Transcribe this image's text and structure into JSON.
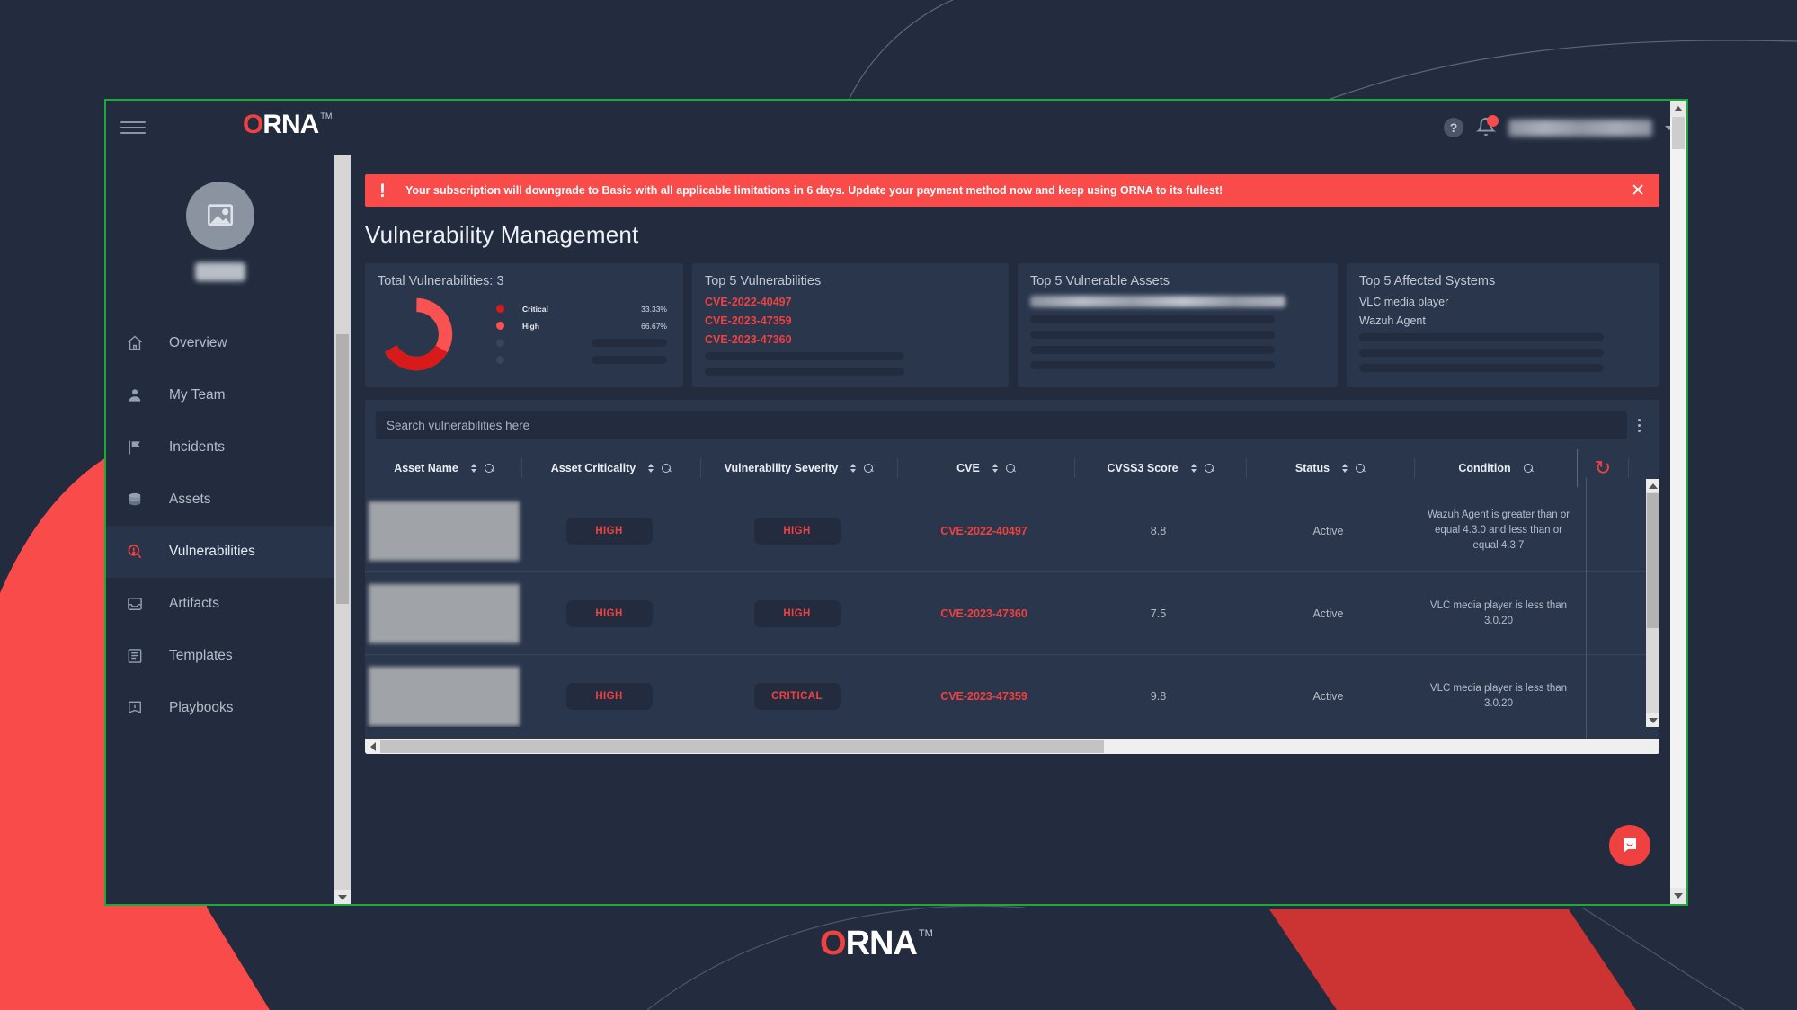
{
  "brand": {
    "name_o": "O",
    "name_rest": "RNA",
    "tm": "TM",
    "accent_red": "#f04141",
    "bg_navy": "#222c3e",
    "card_navy": "#2a364c",
    "border_green": "#1ea838"
  },
  "appbar": {
    "menu_icon": "hamburger-icon",
    "help_icon": "?",
    "bell_icon": "bell-icon",
    "user_email_redacted": "",
    "caret": "chevron-down-icon"
  },
  "sidebar": {
    "avatar_icon": "image-placeholder-icon",
    "user_name_redacted": "",
    "items": [
      {
        "label": "Overview",
        "icon": "home-icon",
        "active": false
      },
      {
        "label": "My Team",
        "icon": "user-icon",
        "active": false
      },
      {
        "label": "Incidents",
        "icon": "flag-icon",
        "active": false
      },
      {
        "label": "Assets",
        "icon": "database-icon",
        "active": false
      },
      {
        "label": "Vulnerabilities",
        "icon": "search-alert-icon",
        "active": true
      },
      {
        "label": "Artifacts",
        "icon": "inbox-icon",
        "active": false
      },
      {
        "label": "Templates",
        "icon": "document-icon",
        "active": false
      },
      {
        "label": "Playbooks",
        "icon": "book-icon",
        "active": false
      }
    ]
  },
  "alert": {
    "icon": "exclamation-icon",
    "message": "Your subscription will downgrade to Basic with all applicable limitations in 6 days. Update your payment method now and keep using ORNA to its fullest!",
    "close": "✕"
  },
  "page": {
    "title": "Vulnerability Management"
  },
  "cards": {
    "total": {
      "title": "Total Vulnerabilities: 3"
    },
    "top_vulns": {
      "title": "Top 5 Vulnerabilities",
      "items": [
        "CVE-2022-40497",
        "CVE-2023-47359",
        "CVE-2023-47360"
      ],
      "placeholders": 2
    },
    "top_assets": {
      "title": "Top 5 Vulnerable Assets",
      "redacted_items": 1,
      "placeholders": 4
    },
    "top_systems": {
      "title": "Top 5 Affected Systems",
      "items": [
        "VLC media player",
        "Wazuh Agent"
      ],
      "placeholders": 3
    }
  },
  "chart_data": {
    "type": "pie",
    "title": "Total Vulnerabilities: 3",
    "labels": [
      "Critical",
      "High"
    ],
    "values": [
      33.33,
      66.67
    ],
    "value_labels": [
      "33.33%",
      "66.67%"
    ],
    "colors": [
      "#d81a1a",
      "#fa5151"
    ],
    "legend": "right",
    "donut": true,
    "empty_legend_rows": 2
  },
  "search": {
    "placeholder": "Search vulnerabilities here",
    "value": "",
    "menu_icon": "kebab-menu-icon"
  },
  "table": {
    "columns": [
      {
        "label": "Asset Name",
        "sortable": true,
        "searchable": true
      },
      {
        "label": "Asset Criticality",
        "sortable": true,
        "searchable": true
      },
      {
        "label": "Vulnerability Severity",
        "sortable": true,
        "searchable": true
      },
      {
        "label": "CVE",
        "sortable": true,
        "searchable": true
      },
      {
        "label": "CVSS3 Score",
        "sortable": true,
        "searchable": true
      },
      {
        "label": "Status",
        "sortable": true,
        "searchable": true
      },
      {
        "label": "Condition",
        "sortable": false,
        "searchable": true
      }
    ],
    "refresh_icon": "refresh-icon",
    "rows": [
      {
        "asset_name_redacted": "",
        "criticality": "HIGH",
        "severity": "HIGH",
        "cve": "CVE-2022-40497",
        "score": "8.8",
        "status": "Active",
        "condition": "Wazuh Agent is greater than or equal 4.3.0 and less than or equal 4.3.7"
      },
      {
        "asset_name_redacted": "",
        "criticality": "HIGH",
        "severity": "HIGH",
        "cve": "CVE-2023-47360",
        "score": "7.5",
        "status": "Active",
        "condition": "VLC media player is less than 3.0.20"
      },
      {
        "asset_name_redacted": "",
        "criticality": "HIGH",
        "severity": "CRITICAL",
        "cve": "CVE-2023-47359",
        "score": "9.8",
        "status": "Active",
        "condition": "VLC media player is less than 3.0.20"
      }
    ]
  },
  "chat": {
    "icon": "chat-bubble-icon"
  },
  "footer": {
    "logo_o": "O",
    "logo_rest": "RNA",
    "tm": "TM"
  }
}
